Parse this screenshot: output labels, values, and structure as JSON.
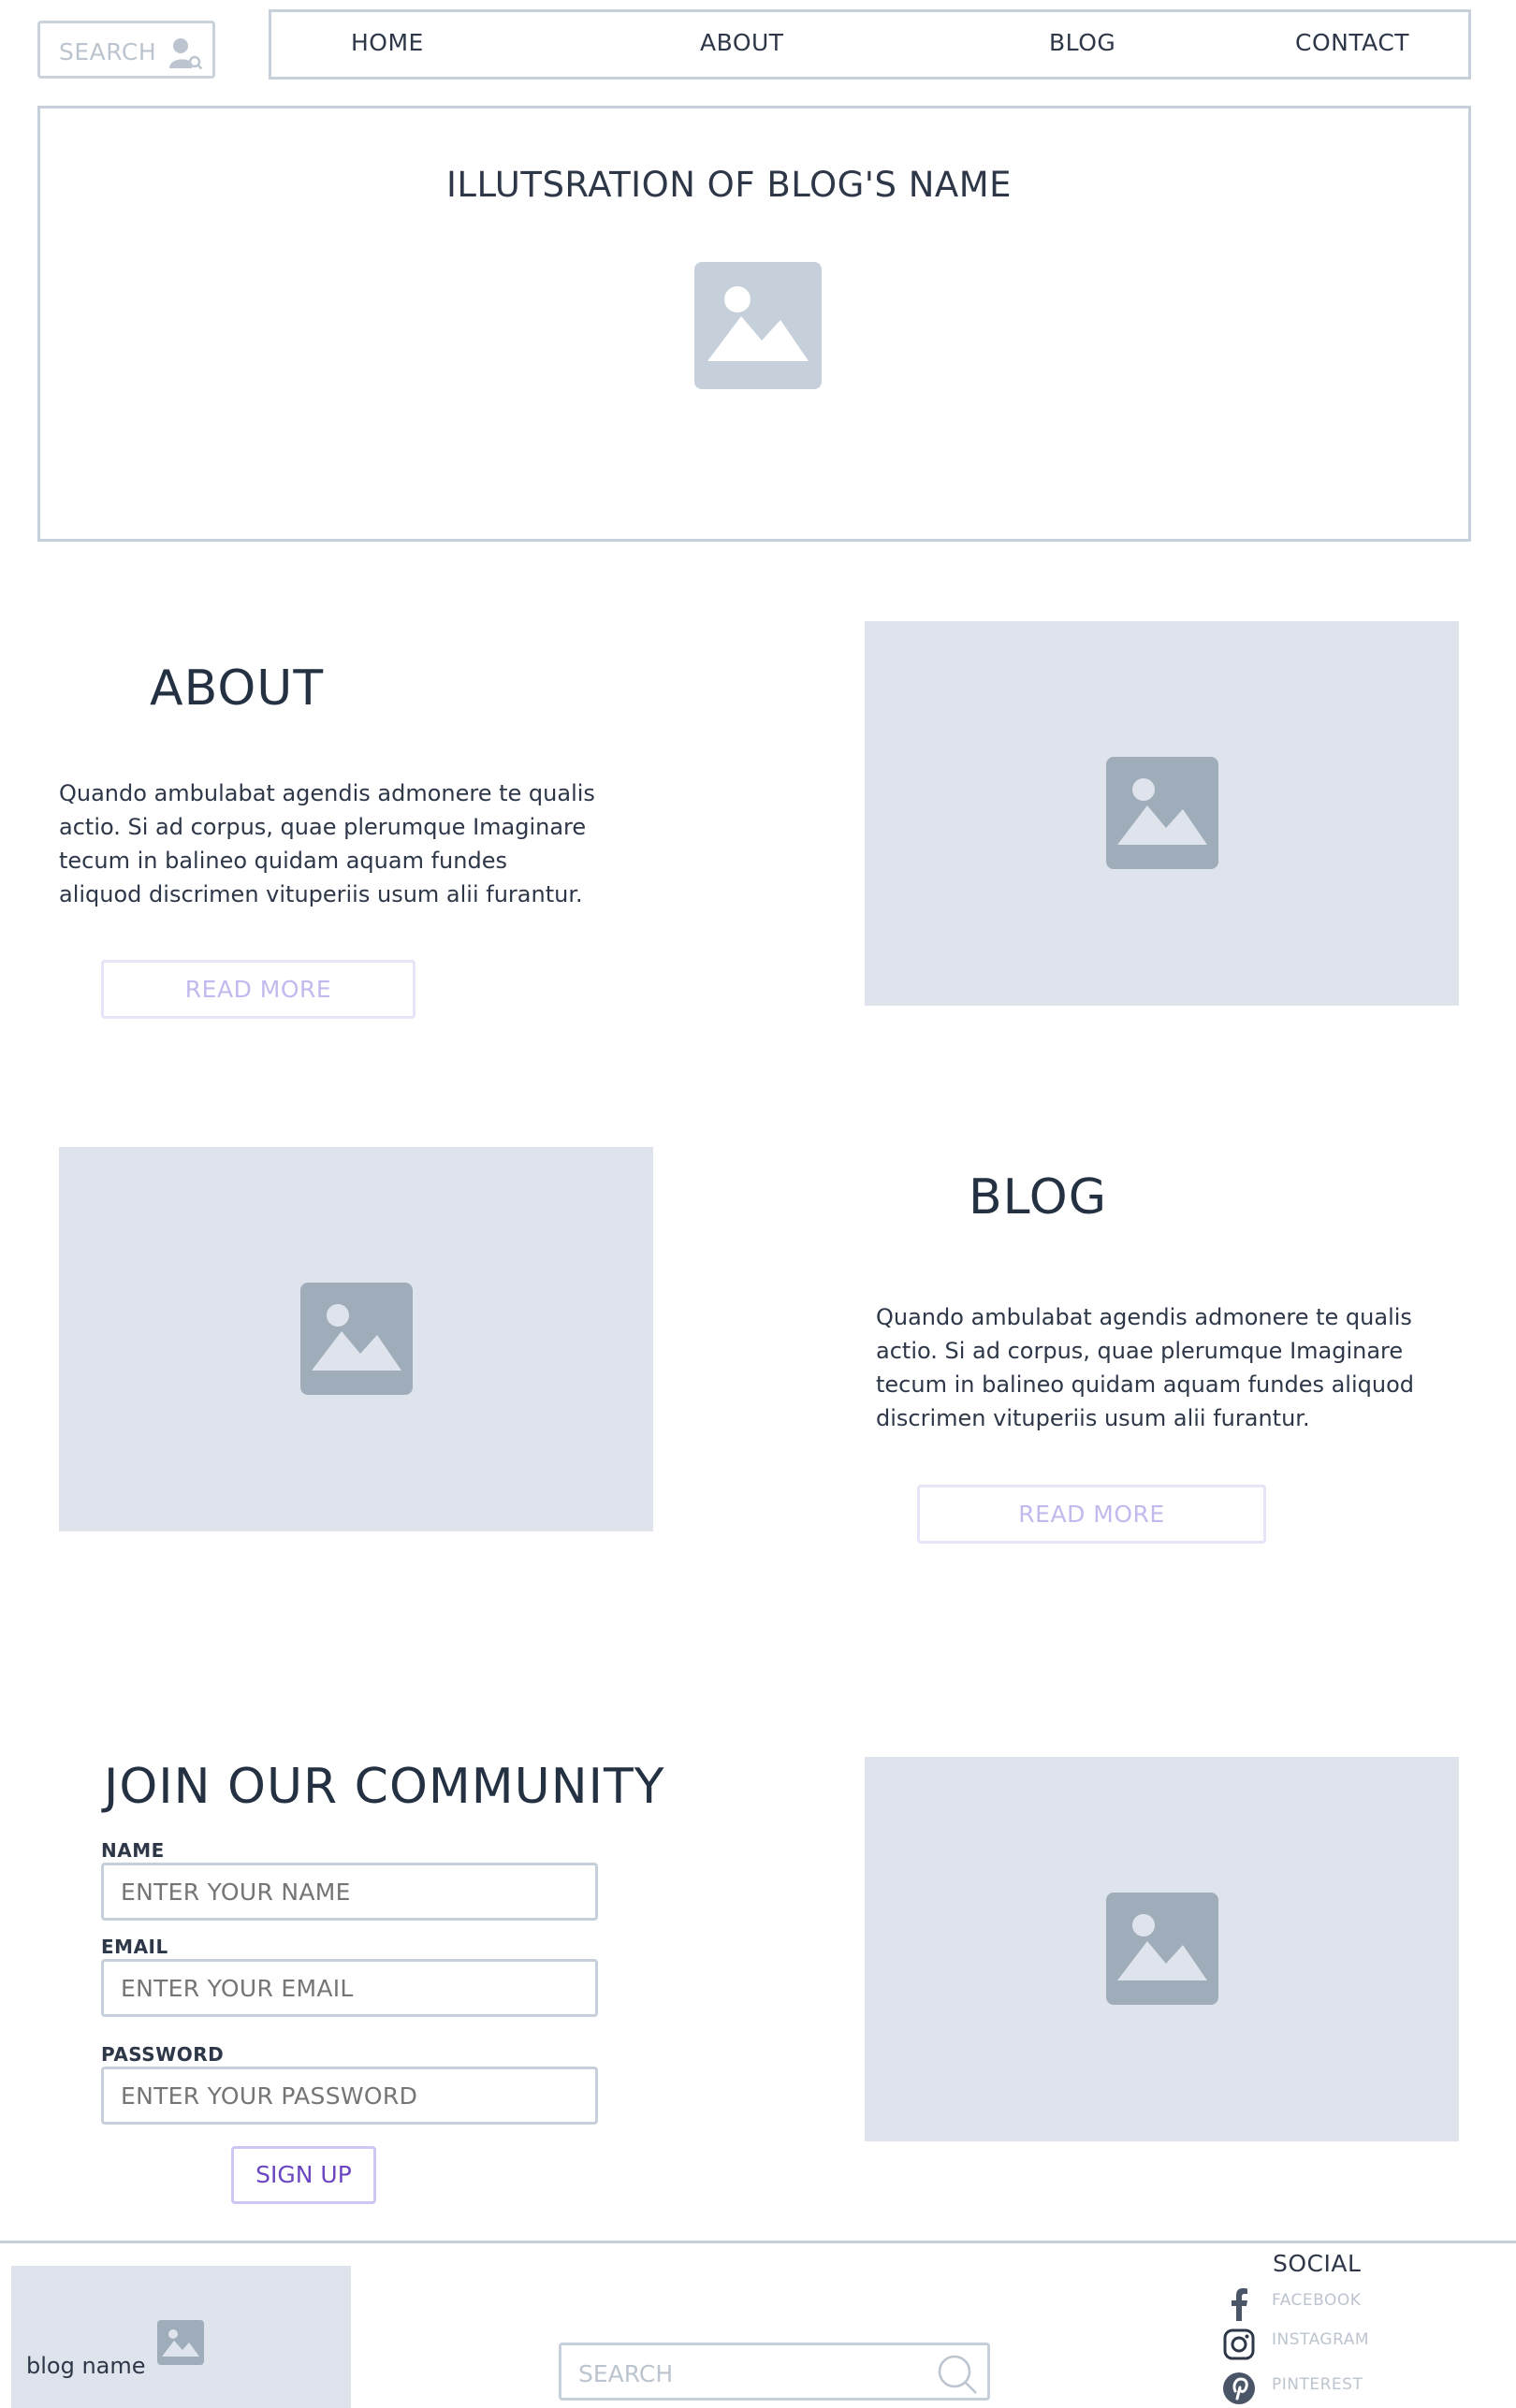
{
  "search": {
    "placeholder": "SEARCH"
  },
  "nav": {
    "items": [
      "HOME",
      "ABOUT",
      "BLOG",
      "CONTACT"
    ]
  },
  "hero": {
    "title": "ILLUTSRATION OF BLOG'S NAME"
  },
  "about": {
    "heading": "ABOUT",
    "lines": [
      "Quando ambulabat agendis admonere te qualis",
      "actio. Si ad corpus, quae plerumque Imaginare",
      "tecum in balineo quidam aquam fundes",
      "aliquod discrimen vituperiis usum alii furantur."
    ],
    "button": "READ MORE"
  },
  "blog": {
    "heading": "BLOG",
    "lines": [
      "Quando ambulabat agendis admonere te qualis",
      "actio. Si ad corpus, quae plerumque Imaginare",
      "tecum in balineo quidam aquam fundes aliquod",
      "discrimen vituperiis usum alii furantur."
    ],
    "button": "READ MORE"
  },
  "community": {
    "heading": "JOIN OUR COMMUNITY",
    "fields": [
      {
        "label": "NAME",
        "placeholder": "ENTER YOUR NAME"
      },
      {
        "label": "EMAIL",
        "placeholder": "ENTER YOUR EMAIL"
      },
      {
        "label": "PASSWORD",
        "placeholder": "ENTER YOUR PASSWORD"
      }
    ],
    "button": "SIGN UP"
  },
  "footer": {
    "brand": "blog name",
    "search_placeholder": "SEARCH",
    "social_title": "SOCIAL",
    "social": [
      {
        "label": "FACEBOOK",
        "icon": "facebook-icon"
      },
      {
        "label": "INSTAGRAM",
        "icon": "instagram-icon"
      },
      {
        "label": "PINTEREST",
        "icon": "pinterest-icon"
      }
    ]
  },
  "colors": {
    "border": "#c6d0da",
    "placeholder_bg": "#dfe4ec",
    "image_icon_light": "#c6d0da",
    "image_icon_dark": "#9fadba",
    "accent": "#6b46c1",
    "button_text_light": "#c3b9ee"
  }
}
